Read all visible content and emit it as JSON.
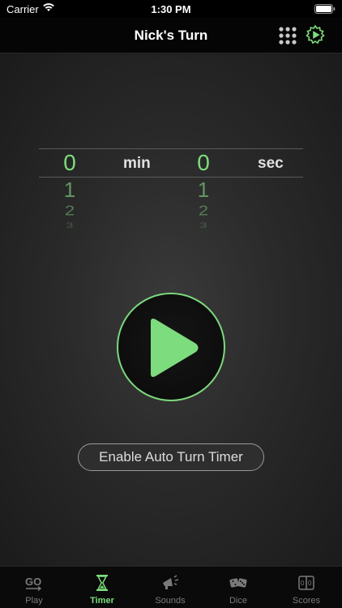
{
  "status_bar": {
    "carrier": "Carrier",
    "time": "1:30 PM"
  },
  "nav": {
    "title": "Nick's Turn"
  },
  "picker": {
    "minutes": {
      "selected": "0",
      "next": [
        "1",
        "2",
        "3"
      ]
    },
    "min_label": "min",
    "seconds": {
      "selected": "0",
      "next": [
        "1",
        "2",
        "3"
      ]
    },
    "sec_label": "sec"
  },
  "auto_turn_button": "Enable Auto Turn Timer",
  "tabs": [
    {
      "label": "Play",
      "icon": "go-icon",
      "active": false
    },
    {
      "label": "Timer",
      "icon": "hourglass-icon",
      "active": true
    },
    {
      "label": "Sounds",
      "icon": "megaphone-icon",
      "active": false
    },
    {
      "label": "Dice",
      "icon": "dice-icon",
      "active": false
    },
    {
      "label": "Scores",
      "icon": "scoreboard-icon",
      "active": false
    }
  ],
  "colors": {
    "accent": "#7ddc7d",
    "background": "#1a1a1a",
    "tab_inactive": "#7a7a7a"
  }
}
